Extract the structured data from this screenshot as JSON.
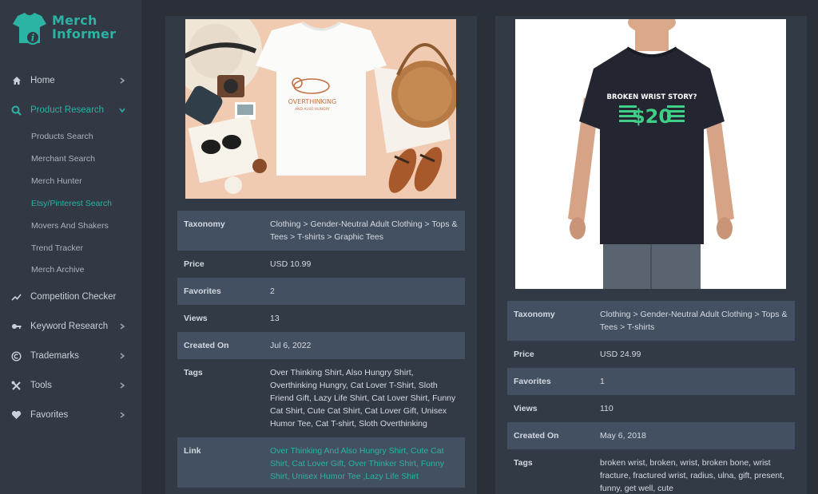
{
  "brand": {
    "line1": "Merch",
    "line2": "Informer",
    "accent": "#2bb3a3"
  },
  "sidebar": {
    "items": [
      {
        "label": "Home",
        "icon": "home-icon",
        "chevron": "right"
      },
      {
        "label": "Product Research",
        "icon": "search-icon",
        "chevron": "down",
        "active": true
      },
      {
        "label": "Competition Checker",
        "icon": "trending-icon"
      },
      {
        "label": "Keyword Research",
        "icon": "key-icon",
        "chevron": "right"
      },
      {
        "label": "Trademarks",
        "icon": "copyright-icon",
        "chevron": "right"
      },
      {
        "label": "Tools",
        "icon": "tools-icon",
        "chevron": "right"
      },
      {
        "label": "Favorites",
        "icon": "heart-icon",
        "chevron": "right"
      }
    ],
    "subitems": [
      {
        "label": "Products Search"
      },
      {
        "label": "Merchant Search"
      },
      {
        "label": "Merch Hunter"
      },
      {
        "label": "Etsy/Pinterest Search",
        "active": true
      },
      {
        "label": "Movers And Shakers"
      },
      {
        "label": "Trend Tracker"
      },
      {
        "label": "Merch Archive"
      }
    ]
  },
  "products": [
    {
      "image_text": {
        "line1": "OVERTHINKING",
        "line2": "AND ALSO HUNGRY"
      },
      "fields": {
        "taxonomy": {
          "label": "Taxonomy",
          "value": "Clothing > Gender-Neutral Adult Clothing > Tops & Tees > T-shirts > Graphic Tees"
        },
        "price": {
          "label": "Price",
          "value": "USD 10.99"
        },
        "favorites": {
          "label": "Favorites",
          "value": "2"
        },
        "views": {
          "label": "Views",
          "value": "13"
        },
        "created": {
          "label": "Created On",
          "value": "Jul 6, 2022"
        },
        "tags": {
          "label": "Tags",
          "value": "Over Thinking Shirt, Also Hungry Shirt, Overthinking Hungry, Cat Lover T-Shirt, Sloth Friend Gift, Lazy Life Shirt, Cat Lover Shirt, Funny Cat Shirt, Cute Cat Shirt, Cat Lover Gift, Unisex Humor Tee, Cat T-shirt, Sloth Overthinking"
        },
        "link": {
          "label": "Link",
          "value": "Over Thinking And Also Hungry Shirt, Cute Cat Shirt, Cat Lover Gift, Over Thinker Shirt, Funny Shirt, Unisex Humor Tee ,Lazy Life Shirt"
        }
      }
    },
    {
      "image_text": {
        "line1": "BROKEN WRIST STORY?",
        "line2": "$20"
      },
      "fields": {
        "taxonomy": {
          "label": "Taxonomy",
          "value": "Clothing > Gender-Neutral Adult Clothing > Tops & Tees > T-shirts"
        },
        "price": {
          "label": "Price",
          "value": "USD 24.99"
        },
        "favorites": {
          "label": "Favorites",
          "value": "1"
        },
        "views": {
          "label": "Views",
          "value": "110"
        },
        "created": {
          "label": "Created On",
          "value": "May 6, 2018"
        },
        "tags": {
          "label": "Tags",
          "value": "broken wrist, broken, wrist, broken bone, wrist fracture, fractured wrist, radius, ulna, gift, present, funny, get well, cute"
        }
      }
    }
  ]
}
